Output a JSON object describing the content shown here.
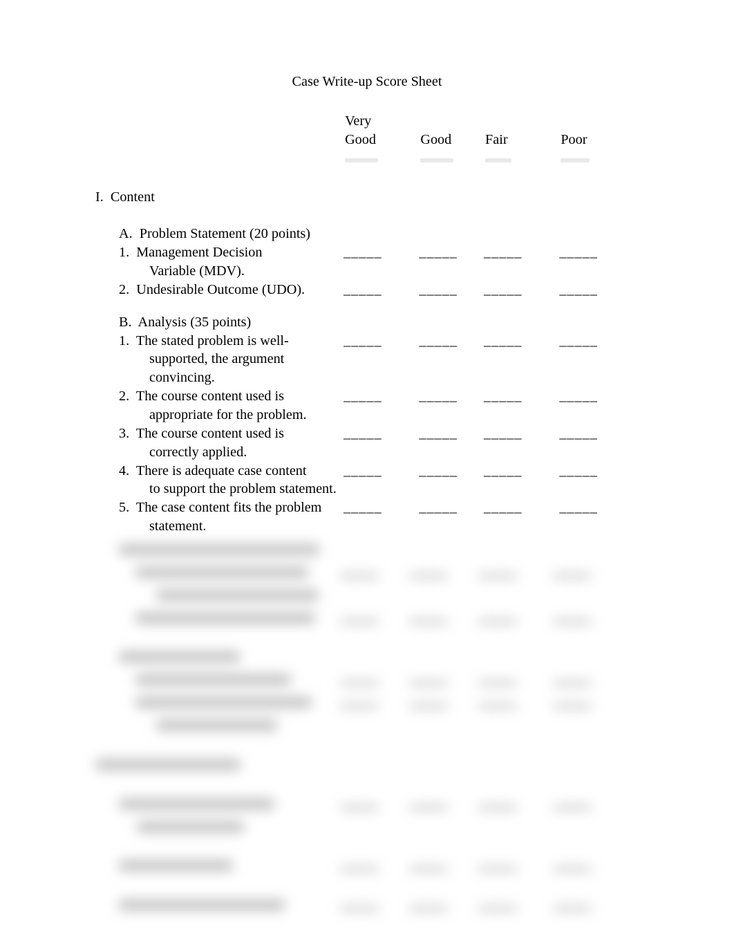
{
  "title": "Case Write-up Score Sheet",
  "columns": {
    "veryGood_line1": "Very",
    "veryGood_line2": "Good",
    "good": "Good",
    "fair": "Fair",
    "poor": "Poor"
  },
  "section1": {
    "roman": "I.",
    "title": "Content"
  },
  "subA": {
    "letter": "A.",
    "title": "Problem Statement (20 points)",
    "items": {
      "i1_num": "1.",
      "i1_text": "Management Decision",
      "i1_cont": "Variable (MDV).",
      "i2_num": "2.",
      "i2_text": "Undesirable Outcome (UDO)."
    }
  },
  "subB": {
    "letter": "B.",
    "title": "Analysis (35 points)",
    "items": {
      "i1_num": "1.",
      "i1_text": "The stated problem is well-",
      "i1_cont1": "supported, the argument",
      "i1_cont2": "convincing.",
      "i2_num": "2.",
      "i2_text": "The course content used is",
      "i2_cont": "appropriate for the problem.",
      "i3_num": "3.",
      "i3_text": "The course content used is",
      "i3_cont": "correctly applied.",
      "i4_num": "4.",
      "i4_text": "There is adequate case content",
      "i4_cont": "to support the problem statement.",
      "i5_num": "5.",
      "i5_text": "The case content fits the problem",
      "i5_cont": "statement."
    }
  },
  "rule": "_____"
}
